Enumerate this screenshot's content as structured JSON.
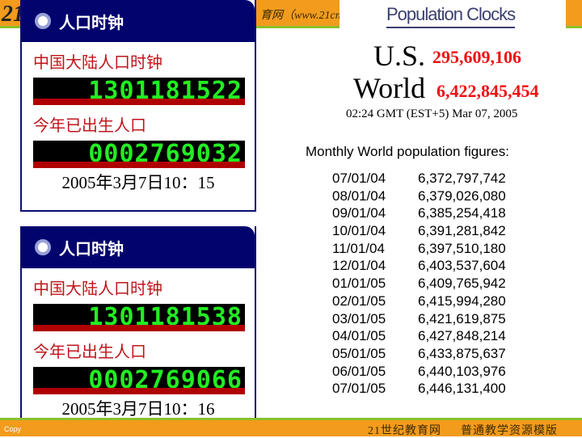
{
  "header": {
    "logo": "21",
    "site_text": "育网（www.21cn"
  },
  "footer": {
    "copy": "Copy",
    "site": "21世纪教育网",
    "slogan": "普通教学资源模版"
  },
  "panels": [
    {
      "title": "人口时钟",
      "china_label": "中国大陆人口时钟",
      "china_value": "1301181522",
      "births_label": "今年已出生人口",
      "births_value": "0002769032",
      "timestamp": "2005年3月7日10：15"
    },
    {
      "title": "人口时钟",
      "china_label": "中国大陆人口时钟",
      "china_value": "1301181538",
      "births_label": "今年已出生人口",
      "births_value": "0002769066",
      "timestamp": "2005年3月7日10：16"
    }
  ],
  "population_clocks": {
    "title": "Population Clocks",
    "us_label": "U.S.",
    "us_value": "295,609,106",
    "world_label": "World",
    "world_value": "6,422,845,454",
    "time": "02:24 GMT (EST+5) Mar 07, 2005"
  },
  "monthly": {
    "title": "Monthly World population figures:",
    "rows": [
      {
        "date": "07/01/04",
        "value": "6,372,797,742"
      },
      {
        "date": "08/01/04",
        "value": "6,379,026,080"
      },
      {
        "date": "09/01/04",
        "value": "6,385,254,418"
      },
      {
        "date": "10/01/04",
        "value": "6,391,281,842"
      },
      {
        "date": "11/01/04",
        "value": "6,397,510,180"
      },
      {
        "date": "12/01/04",
        "value": "6,403,537,604"
      },
      {
        "date": "01/01/05",
        "value": "6,409,765,942"
      },
      {
        "date": "02/01/05",
        "value": "6,415,994,280"
      },
      {
        "date": "03/01/05",
        "value": "6,421,619,875"
      },
      {
        "date": "04/01/05",
        "value": "6,427,848,214"
      },
      {
        "date": "05/01/05",
        "value": "6,433,875,637"
      },
      {
        "date": "06/01/05",
        "value": "6,440,103,976"
      },
      {
        "date": "07/01/05",
        "value": "6,446,131,400"
      }
    ]
  },
  "colors": {
    "header_orange": "#f29b1d",
    "accent_green": "#8cbf2a",
    "panel_blue": "#03036e",
    "lcd_green": "#22ee22",
    "label_red": "#c0151b"
  }
}
